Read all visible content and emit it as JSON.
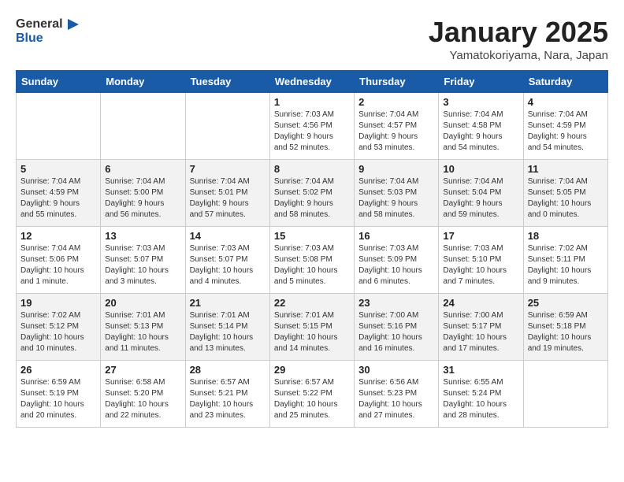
{
  "header": {
    "logo_general": "General",
    "logo_blue": "Blue",
    "title": "January 2025",
    "subtitle": "Yamatokoriyama, Nara, Japan"
  },
  "days_of_week": [
    "Sunday",
    "Monday",
    "Tuesday",
    "Wednesday",
    "Thursday",
    "Friday",
    "Saturday"
  ],
  "weeks": [
    {
      "days": [
        {
          "number": "",
          "detail": ""
        },
        {
          "number": "",
          "detail": ""
        },
        {
          "number": "",
          "detail": ""
        },
        {
          "number": "1",
          "detail": "Sunrise: 7:03 AM\nSunset: 4:56 PM\nDaylight: 9 hours\nand 52 minutes."
        },
        {
          "number": "2",
          "detail": "Sunrise: 7:04 AM\nSunset: 4:57 PM\nDaylight: 9 hours\nand 53 minutes."
        },
        {
          "number": "3",
          "detail": "Sunrise: 7:04 AM\nSunset: 4:58 PM\nDaylight: 9 hours\nand 54 minutes."
        },
        {
          "number": "4",
          "detail": "Sunrise: 7:04 AM\nSunset: 4:59 PM\nDaylight: 9 hours\nand 54 minutes."
        }
      ]
    },
    {
      "days": [
        {
          "number": "5",
          "detail": "Sunrise: 7:04 AM\nSunset: 4:59 PM\nDaylight: 9 hours\nand 55 minutes."
        },
        {
          "number": "6",
          "detail": "Sunrise: 7:04 AM\nSunset: 5:00 PM\nDaylight: 9 hours\nand 56 minutes."
        },
        {
          "number": "7",
          "detail": "Sunrise: 7:04 AM\nSunset: 5:01 PM\nDaylight: 9 hours\nand 57 minutes."
        },
        {
          "number": "8",
          "detail": "Sunrise: 7:04 AM\nSunset: 5:02 PM\nDaylight: 9 hours\nand 58 minutes."
        },
        {
          "number": "9",
          "detail": "Sunrise: 7:04 AM\nSunset: 5:03 PM\nDaylight: 9 hours\nand 58 minutes."
        },
        {
          "number": "10",
          "detail": "Sunrise: 7:04 AM\nSunset: 5:04 PM\nDaylight: 9 hours\nand 59 minutes."
        },
        {
          "number": "11",
          "detail": "Sunrise: 7:04 AM\nSunset: 5:05 PM\nDaylight: 10 hours\nand 0 minutes."
        }
      ]
    },
    {
      "days": [
        {
          "number": "12",
          "detail": "Sunrise: 7:04 AM\nSunset: 5:06 PM\nDaylight: 10 hours\nand 1 minute."
        },
        {
          "number": "13",
          "detail": "Sunrise: 7:03 AM\nSunset: 5:07 PM\nDaylight: 10 hours\nand 3 minutes."
        },
        {
          "number": "14",
          "detail": "Sunrise: 7:03 AM\nSunset: 5:07 PM\nDaylight: 10 hours\nand 4 minutes."
        },
        {
          "number": "15",
          "detail": "Sunrise: 7:03 AM\nSunset: 5:08 PM\nDaylight: 10 hours\nand 5 minutes."
        },
        {
          "number": "16",
          "detail": "Sunrise: 7:03 AM\nSunset: 5:09 PM\nDaylight: 10 hours\nand 6 minutes."
        },
        {
          "number": "17",
          "detail": "Sunrise: 7:03 AM\nSunset: 5:10 PM\nDaylight: 10 hours\nand 7 minutes."
        },
        {
          "number": "18",
          "detail": "Sunrise: 7:02 AM\nSunset: 5:11 PM\nDaylight: 10 hours\nand 9 minutes."
        }
      ]
    },
    {
      "days": [
        {
          "number": "19",
          "detail": "Sunrise: 7:02 AM\nSunset: 5:12 PM\nDaylight: 10 hours\nand 10 minutes."
        },
        {
          "number": "20",
          "detail": "Sunrise: 7:01 AM\nSunset: 5:13 PM\nDaylight: 10 hours\nand 11 minutes."
        },
        {
          "number": "21",
          "detail": "Sunrise: 7:01 AM\nSunset: 5:14 PM\nDaylight: 10 hours\nand 13 minutes."
        },
        {
          "number": "22",
          "detail": "Sunrise: 7:01 AM\nSunset: 5:15 PM\nDaylight: 10 hours\nand 14 minutes."
        },
        {
          "number": "23",
          "detail": "Sunrise: 7:00 AM\nSunset: 5:16 PM\nDaylight: 10 hours\nand 16 minutes."
        },
        {
          "number": "24",
          "detail": "Sunrise: 7:00 AM\nSunset: 5:17 PM\nDaylight: 10 hours\nand 17 minutes."
        },
        {
          "number": "25",
          "detail": "Sunrise: 6:59 AM\nSunset: 5:18 PM\nDaylight: 10 hours\nand 19 minutes."
        }
      ]
    },
    {
      "days": [
        {
          "number": "26",
          "detail": "Sunrise: 6:59 AM\nSunset: 5:19 PM\nDaylight: 10 hours\nand 20 minutes."
        },
        {
          "number": "27",
          "detail": "Sunrise: 6:58 AM\nSunset: 5:20 PM\nDaylight: 10 hours\nand 22 minutes."
        },
        {
          "number": "28",
          "detail": "Sunrise: 6:57 AM\nSunset: 5:21 PM\nDaylight: 10 hours\nand 23 minutes."
        },
        {
          "number": "29",
          "detail": "Sunrise: 6:57 AM\nSunset: 5:22 PM\nDaylight: 10 hours\nand 25 minutes."
        },
        {
          "number": "30",
          "detail": "Sunrise: 6:56 AM\nSunset: 5:23 PM\nDaylight: 10 hours\nand 27 minutes."
        },
        {
          "number": "31",
          "detail": "Sunrise: 6:55 AM\nSunset: 5:24 PM\nDaylight: 10 hours\nand 28 minutes."
        },
        {
          "number": "",
          "detail": ""
        }
      ]
    }
  ]
}
